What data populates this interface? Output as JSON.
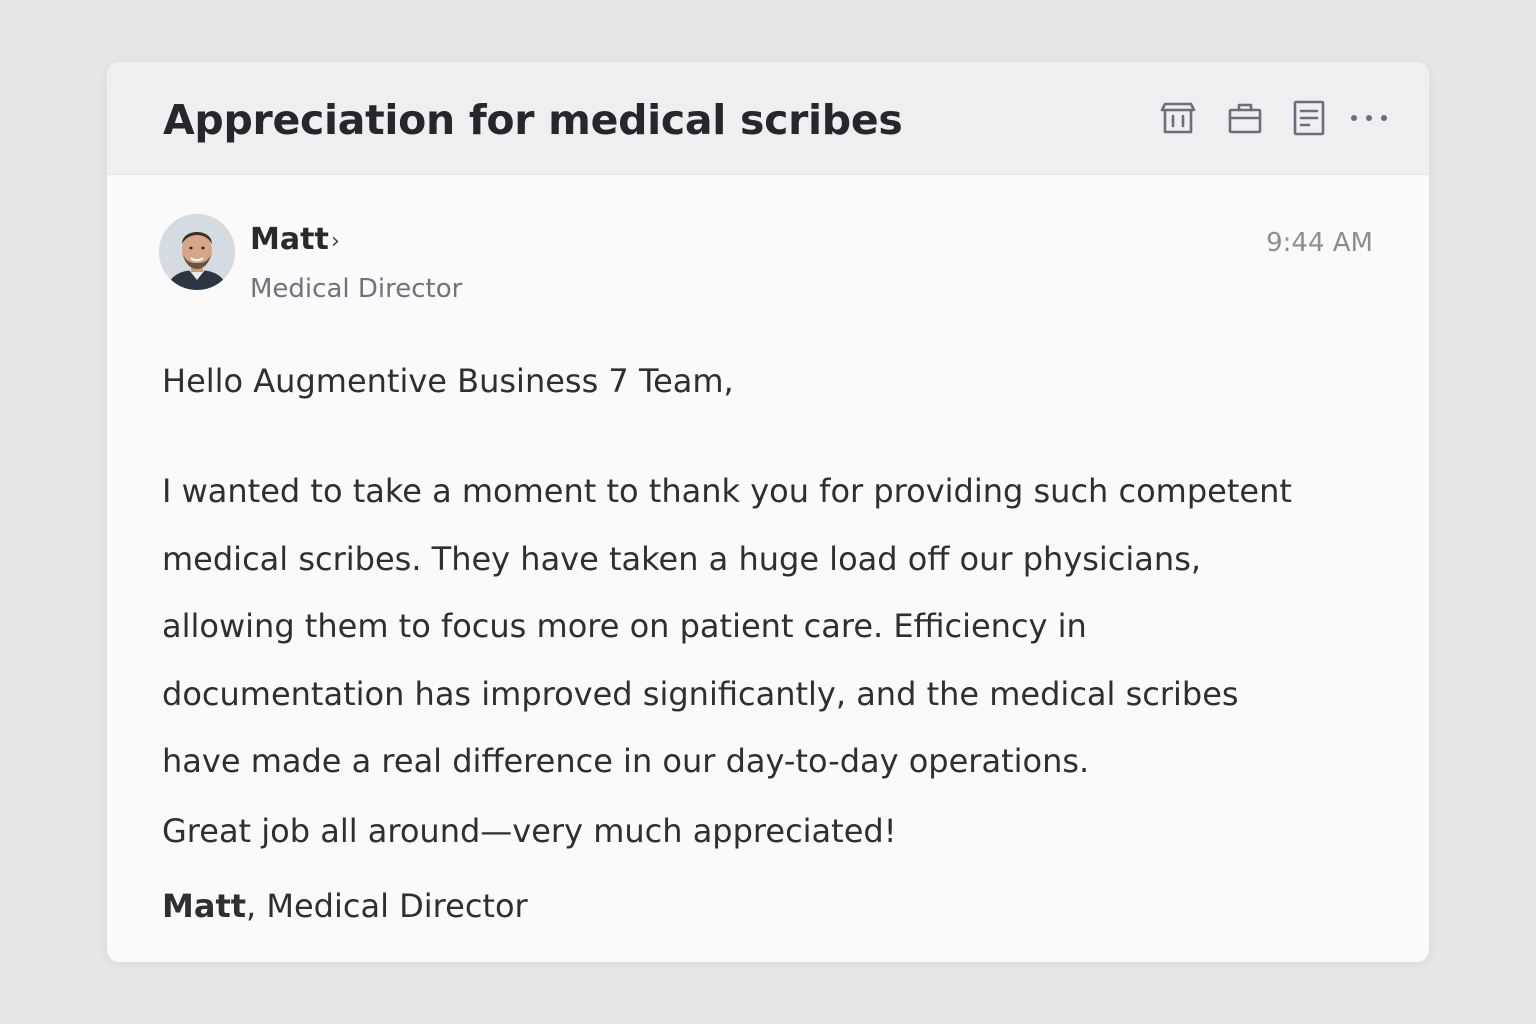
{
  "email": {
    "subject": "Appreciation for medical scribes",
    "toolbar": [
      {
        "icon": "archive-icon"
      },
      {
        "icon": "briefcase-icon"
      },
      {
        "icon": "note-icon"
      },
      {
        "icon": "more-icon"
      }
    ],
    "sender": {
      "name": "Matt",
      "title": "Medical Director",
      "chevron": "›"
    },
    "time": "9:44 AM",
    "greeting": "Hello Augmentive Business 7 Team,",
    "body_lines": [
      "I wanted to take a moment to thank you for providing such competent",
      "medical scribes. They have taken a huge load off our physicians,",
      "allowing them to focus more on patient care. Efficiency in",
      "documentation has improved significantly, and the medical scribes",
      "have made a real difference in our day-to-day operations."
    ],
    "closing": "Great job all around—very much appreciated!",
    "signature": {
      "name": "Matt",
      "rest": ", Medical Director"
    }
  },
  "colors": {
    "background": "#e6e6e9",
    "card": "#fafafa",
    "header": "#efeff1",
    "icon": "#6a6f78"
  }
}
